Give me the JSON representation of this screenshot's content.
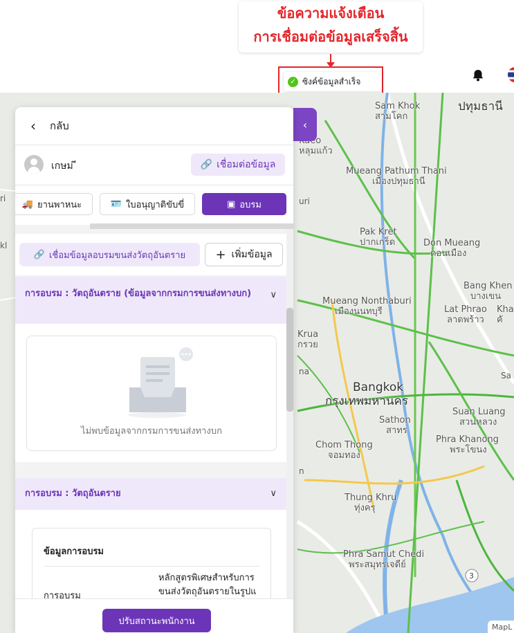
{
  "annotation": {
    "line1": "ข้อความแจ้งเตือน",
    "line2": "การเชื่อมต่อข้อมูลเสร็จสิ้น"
  },
  "toast": {
    "message": "ซิงค์ข้อมูลสำเร็จ"
  },
  "map": {
    "labels": [
      {
        "en": "Sam Khok",
        "th": "สามโคก"
      },
      {
        "en": "",
        "th": "ปทุมธานี"
      },
      {
        "en": "Kaeo",
        "th": "หลุมแก้ว"
      },
      {
        "en": "Mueang Pathum Thani",
        "th": "เมืองปทุมธานี"
      },
      {
        "en": "Pak Kret",
        "th": "ปากเกร็ด"
      },
      {
        "en": "Don Mueang",
        "th": "ดอนเมือง"
      },
      {
        "en": "Bang Khen",
        "th": "บางเขน"
      },
      {
        "en": "Mueang Nonthaburi",
        "th": "เมืองนนทบุรี"
      },
      {
        "en": "Lat Phrao",
        "th": "ลาดพร้าว"
      },
      {
        "en": "Kha",
        "th": "คั"
      },
      {
        "en": "Krua",
        "th": "กรวย"
      },
      {
        "en": "Bangkok",
        "th": "กรุงเทพมหานคร"
      },
      {
        "en": "Sathon",
        "th": "สาทร"
      },
      {
        "en": "Suan Luang",
        "th": "สวนหลวง"
      },
      {
        "en": "Chom Thong",
        "th": "จอมทอง"
      },
      {
        "en": "Phra Khanong",
        "th": "พระโขนง"
      },
      {
        "en": "Thung Khru",
        "th": "ทุ่งครุ"
      },
      {
        "en": "Phra Samut Chedi",
        "th": "พระสมุทรเจดีย์"
      }
    ],
    "left_fragments": {
      "a": "ri",
      "b": "kl",
      "c": "uri",
      "d": "na",
      "e": "n",
      "f": "Sa"
    },
    "route_badge": "3",
    "attribution": "MapL"
  },
  "panel": {
    "back_label": "กลับ",
    "user_name": "เกษม ี",
    "link_data_label": "เชื่อมต่อข้อมูล",
    "tabs": [
      {
        "label": "ยานพาหนะ",
        "icon": "truck-icon"
      },
      {
        "label": "ใบอนุญาติขับขี่",
        "icon": "id-card-icon"
      },
      {
        "label": "อบรม",
        "icon": "training-icon",
        "active": true
      }
    ],
    "link_training_label": "เชื่อมข้อมูลอบรมขนส่งวัตถุอันตราย",
    "add_label": "เพิ่มข้อมูล",
    "section1": {
      "title": "การอบรม : วัตถุอันตราย (ข้อมูลจากกรมการขนส่งทางบก)",
      "empty_text": "ไม่พบข้อมูลจากกรมการขนส่งทางบก"
    },
    "section2": {
      "title": "การอบรม : วัตถุอันตราย",
      "card_title": "ข้อมูลการอบรม",
      "row_key": "การอบรม",
      "row_value": "หลักสูตรพิเศษสำหรับการขนส่งวัตถุอันตรายในรูปแ"
    },
    "footer_button": "ปรับสถานะพนักงาน"
  },
  "colors": {
    "accent": "#6c35b8",
    "accent_light": "#efe8fa",
    "alert": "#e3262b",
    "success": "#52c41a"
  }
}
